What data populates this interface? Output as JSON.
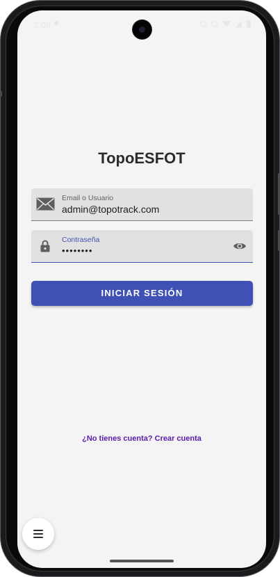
{
  "status_bar": {
    "time": "2:08"
  },
  "app": {
    "title": "TopoESFOT"
  },
  "email_field": {
    "label": "Email o Usuario",
    "value": "admin@topotrack.com",
    "icon": "mail-icon"
  },
  "password_field": {
    "label": "Contraseña",
    "value": "••••••••",
    "icon": "lock-icon",
    "toggle_icon": "eye-icon"
  },
  "login_button": {
    "label": "INICIAR SESIÓN"
  },
  "register_link": {
    "label": "¿No tienes cuenta? Crear cuenta"
  },
  "fab": {
    "icon": "menu-icon"
  },
  "colors": {
    "primary": "#3f51b5",
    "link": "#5b1aa8",
    "background": "#f4f4f4",
    "field_bg": "#e1e1e1"
  }
}
